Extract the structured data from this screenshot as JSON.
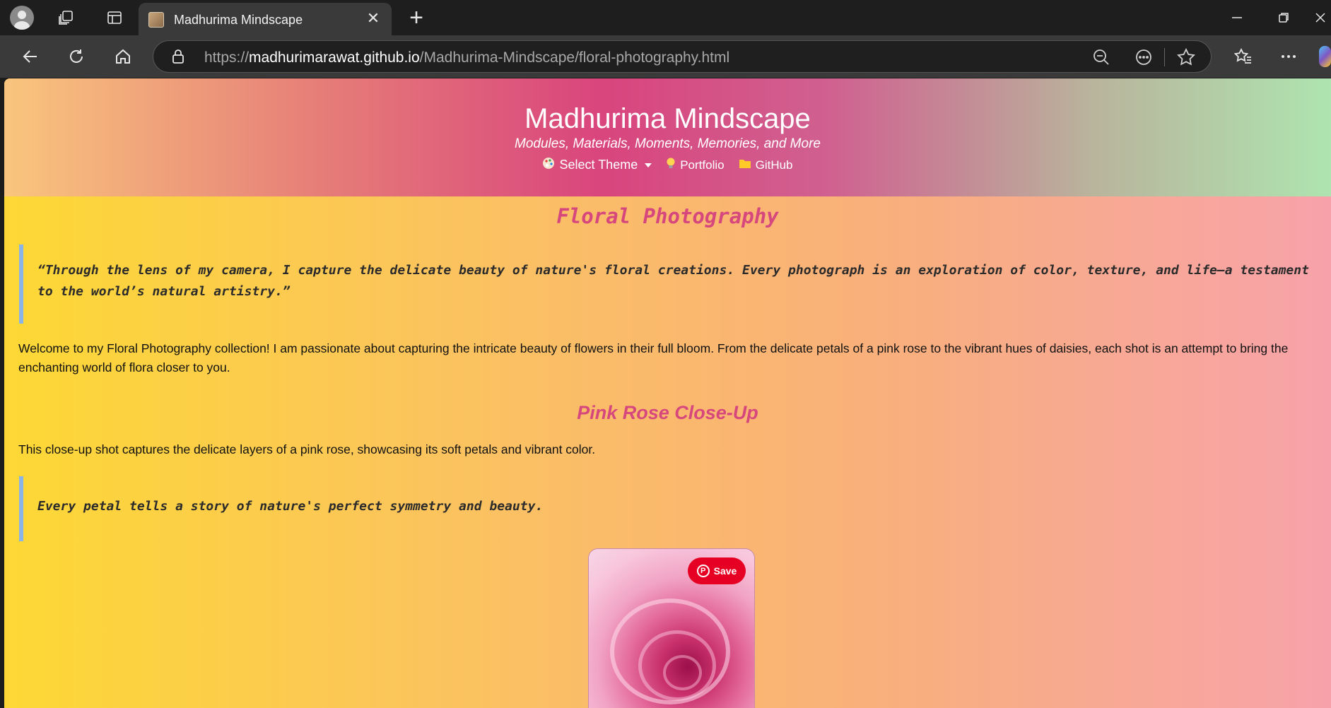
{
  "browser": {
    "tab_title": "Madhurima Mindscape",
    "tab_close": "✕",
    "new_tab": "+",
    "url_prefix": "https://",
    "url_host": "madhurimarawat.github.io",
    "url_path": "/Madhurima-Mindscape/floral-photography.html"
  },
  "site": {
    "title": "Madhurima Mindscape",
    "subtitle": "Modules, Materials, Moments, Memories, and More",
    "nav": {
      "theme_label": "Select Theme",
      "portfolio_label": "Portfolio",
      "github_label": "GitHub"
    }
  },
  "content": {
    "heading": "Floral Photography",
    "quote1": "“Through the lens of my camera, I capture the delicate beauty of nature's floral creations. Every photograph is an exploration of color, texture, and life—a testament to the world’s natural artistry.”",
    "intro": "Welcome to my Floral Photography collection! I am passionate about capturing the intricate beauty of flowers in their full bloom. From the delicate petals of a pink rose to the vibrant hues of daisies, each shot is an attempt to bring the enchanting world of flora closer to you.",
    "section_heading": "Pink Rose Close-Up",
    "section_text": "This close-up shot captures the delicate layers of a pink rose, showcasing its soft petals and vibrant color.",
    "quote2": "Every petal tells a story of nature's perfect symmetry and beauty.",
    "save_label": "Save"
  },
  "colors": {
    "accent": "#d6477d",
    "quote_border": "#8ab4e8",
    "pinterest": "#e60023"
  },
  "icons": [
    "profile-icon",
    "workspaces-icon",
    "tab-actions-icon",
    "back-icon",
    "refresh-icon",
    "home-icon",
    "lock-icon",
    "zoom-out-icon",
    "read-aloud-icon",
    "favorite-star-icon",
    "favorites-icon",
    "more-icon",
    "palette-icon",
    "bulb-icon",
    "folder-icon",
    "pinterest-icon"
  ]
}
